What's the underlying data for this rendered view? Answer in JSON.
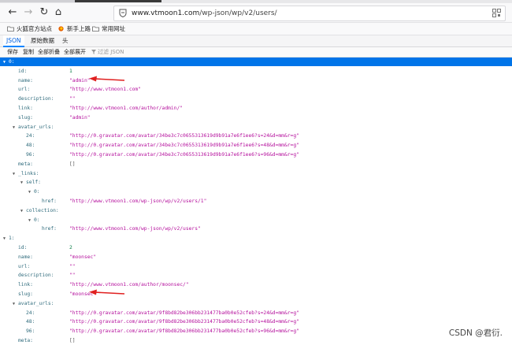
{
  "address_bar": {
    "url_host": "www.vtmoon1.com",
    "url_path": "/wp-json/wp/v2/users/"
  },
  "bookmarks": [
    {
      "label": "火狐官方站点"
    },
    {
      "label": "新手上路"
    },
    {
      "label": "常用网址"
    }
  ],
  "viewer_tabs": [
    {
      "label": "JSON"
    },
    {
      "label": "原始数据"
    },
    {
      "label": "头"
    }
  ],
  "toolbar": {
    "save": "保存",
    "copy": "复制",
    "collapse_all": "全部折叠",
    "expand_all": "全部展开",
    "filter_placeholder": "过滤 JSON"
  },
  "json_rows": [
    {
      "key": "0:",
      "indent": 0,
      "toggle": true,
      "selected": true
    },
    {
      "key": "id:",
      "indent": 1,
      "value": "1",
      "vtype": "num"
    },
    {
      "key": "name:",
      "indent": 1,
      "value": "\"admin\"",
      "vtype": "str",
      "arrow": true
    },
    {
      "key": "url:",
      "indent": 1,
      "value": "\"http://www.vtmoon1.com\"",
      "vtype": "str"
    },
    {
      "key": "description:",
      "indent": 1,
      "value": "\"\"",
      "vtype": "str"
    },
    {
      "key": "link:",
      "indent": 1,
      "value": "\"http://www.vtmoon1.com/author/admin/\"",
      "vtype": "str"
    },
    {
      "key": "slug:",
      "indent": 1,
      "value": "\"admin\"",
      "vtype": "str"
    },
    {
      "key": "avatar_urls:",
      "indent": 1,
      "toggle": true
    },
    {
      "key": "24:",
      "indent": 2,
      "value": "\"http://0.gravatar.com/avatar/34be3c7c0655313619d9b91a7e6f1ee6?s=24&d=mm&r=g\"",
      "vtype": "str"
    },
    {
      "key": "48:",
      "indent": 2,
      "value": "\"http://0.gravatar.com/avatar/34be3c7c0655313619d9b91a7e6f1ee6?s=48&d=mm&r=g\"",
      "vtype": "str"
    },
    {
      "key": "96:",
      "indent": 2,
      "value": "\"http://0.gravatar.com/avatar/34be3c7c0655313619d9b91a7e6f1ee6?s=96&d=mm&r=g\"",
      "vtype": "str"
    },
    {
      "key": "meta:",
      "indent": 1,
      "value": "[]",
      "vtype": "obj"
    },
    {
      "key": "_links:",
      "indent": 1,
      "toggle": true
    },
    {
      "key": "self:",
      "indent": 2,
      "toggle": true
    },
    {
      "key": "0:",
      "indent": 3,
      "toggle": true
    },
    {
      "key": "href:",
      "indent": 4,
      "value": "\"http://www.vtmoon1.com/wp-json/wp/v2/users/1\"",
      "vtype": "str"
    },
    {
      "key": "collection:",
      "indent": 2,
      "toggle": true
    },
    {
      "key": "0:",
      "indent": 3,
      "toggle": true
    },
    {
      "key": "href:",
      "indent": 4,
      "value": "\"http://www.vtmoon1.com/wp-json/wp/v2/users\"",
      "vtype": "str"
    },
    {
      "key": "1:",
      "indent": 0,
      "toggle": true
    },
    {
      "key": "id:",
      "indent": 1,
      "value": "2",
      "vtype": "num"
    },
    {
      "key": "name:",
      "indent": 1,
      "value": "\"moonsec\"",
      "vtype": "str"
    },
    {
      "key": "url:",
      "indent": 1,
      "value": "\"\"",
      "vtype": "str"
    },
    {
      "key": "description:",
      "indent": 1,
      "value": "\"\"",
      "vtype": "str"
    },
    {
      "key": "link:",
      "indent": 1,
      "value": "\"http://www.vtmoon1.com/author/moonsec/\"",
      "vtype": "str"
    },
    {
      "key": "slug:",
      "indent": 1,
      "value": "\"moonsec\"",
      "vtype": "str",
      "arrow": true
    },
    {
      "key": "avatar_urls:",
      "indent": 1,
      "toggle": true
    },
    {
      "key": "24:",
      "indent": 2,
      "value": "\"http://0.gravatar.com/avatar/9f8bd82be306bb231477ba0b0e52cfeb?s=24&d=mm&r=g\"",
      "vtype": "str"
    },
    {
      "key": "48:",
      "indent": 2,
      "value": "\"http://0.gravatar.com/avatar/9f8bd82be306bb231477ba0b0e52cfeb?s=48&d=mm&r=g\"",
      "vtype": "str"
    },
    {
      "key": "96:",
      "indent": 2,
      "value": "\"http://0.gravatar.com/avatar/9f8bd82be306bb231477ba0b0e52cfeb?s=96&d=mm&r=g\"",
      "vtype": "str"
    },
    {
      "key": "meta:",
      "indent": 1,
      "value": "[]",
      "vtype": "obj"
    }
  ],
  "watermark": "CSDN @君衍.",
  "colors": {
    "selected_row": "#0074e8",
    "key": "#2f6b7c",
    "string_value": "#b5119d",
    "number_value": "#0a7c46",
    "annotation_arrow": "#e02020"
  },
  "icons": [
    "back-arrow-icon",
    "forward-arrow-icon",
    "reload-icon",
    "home-icon",
    "shield-icon",
    "qr-code-icon",
    "folder-icon",
    "firefox-icon",
    "filter-icon",
    "triangle-toggle-icon"
  ]
}
